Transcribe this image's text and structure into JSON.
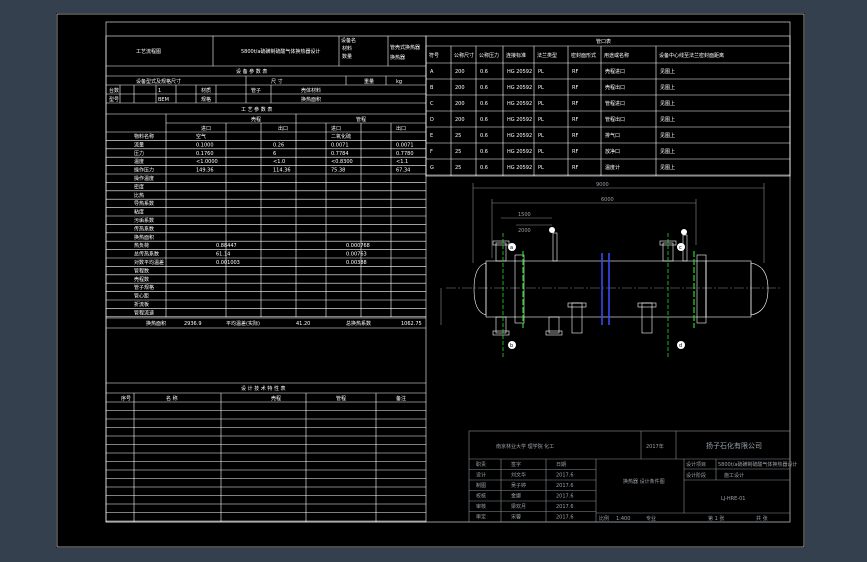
{
  "window": {
    "background": "#34404d",
    "canvas_color": "#000000"
  },
  "header": {
    "left_cell": "工艺流程图",
    "center_cell": "5800t/a硫磺制硫酸气体换热器设计",
    "right_a": "设备名",
    "right_b": "材料",
    "right_c": "换热器",
    "right_d": "管壳式换热器",
    "right_e": "数量"
  },
  "spec_title": "设 备 参 数 表",
  "spec_rows": [
    [
      "设备型式及规格尺寸",
      "尺 寸",
      "",
      "重量",
      "kg"
    ],
    [
      "台数",
      "1",
      "材质",
      "管子",
      "钢",
      "壳体材料",
      "不锈钢"
    ],
    [
      "型号",
      "BEM",
      "规格",
      "",
      "换热面积",
      ""
    ]
  ],
  "process_title": "工 艺 参 数 表",
  "process_headers": [
    "壳程",
    "管程"
  ],
  "process_sub": [
    "进口",
    "出口",
    "进口",
    "出口"
  ],
  "process_labels": [
    "物料名称",
    "流量",
    "压力",
    "温度",
    "操作压力",
    "操作温度",
    "密度",
    "比热",
    "导热系数",
    "粘度",
    "污垢系数",
    "传热系数",
    "换热面积",
    "热负荷",
    "总传热系数",
    "对数平均温差",
    "管程数",
    "壳程数",
    "管子规格",
    "管心距",
    "折流板",
    "管程流速"
  ],
  "process_values": [
    [
      "空气",
      "",
      "二氧化硫",
      ""
    ],
    [
      "0.1000",
      "0.26",
      "0.0071",
      "0.0071"
    ],
    [
      "0.1760",
      "6",
      "0.7784",
      "0.7780"
    ],
    [
      "<1.0000",
      "<1.0",
      "<0.8300",
      "<1.1"
    ],
    [
      "149.36",
      "114.36",
      "75.38",
      "67.34"
    ]
  ],
  "lower_values": [
    "0.88447",
    "0.000768",
    "61.14",
    "0.00763",
    "0.001003",
    "0.00388"
  ],
  "area_row": [
    "换热面积",
    "2936.9",
    "平均温差(实际)",
    "41.20",
    "总换热系数",
    "1062.75"
  ],
  "design_title": "设 计 技 术 特 性 表",
  "design_cols": [
    "序号",
    "名 称",
    "壳程",
    "管程",
    "备注"
  ],
  "nozzle_title": "管口表",
  "nozzle_headers": [
    "符号",
    "公称尺寸",
    "公称压力",
    "连接标准",
    "法兰类型",
    "密封面形式",
    "用途或名称",
    "设备中心线至法兰密封面距离"
  ],
  "nozzles": [
    [
      "A",
      "200",
      "0.6",
      "HG 20592",
      "PL",
      "RF",
      "壳程进口",
      "见图上"
    ],
    [
      "B",
      "200",
      "0.6",
      "HG 20592",
      "PL",
      "RF",
      "壳程出口",
      "见图上"
    ],
    [
      "C",
      "200",
      "0.6",
      "HG 20592",
      "PL",
      "RF",
      "管程进口",
      "见图上"
    ],
    [
      "D",
      "200",
      "0.6",
      "HG 20592",
      "PL",
      "RF",
      "管程出口",
      "见图上"
    ],
    [
      "E",
      "25",
      "0.6",
      "HG 20592",
      "PL",
      "RF",
      "排气口",
      "见图上"
    ],
    [
      "F",
      "25",
      "0.6",
      "HG 20592",
      "PL",
      "RF",
      "放净口",
      "见图上"
    ],
    [
      "G",
      "25",
      "0.6",
      "HG 20592",
      "PL",
      "RF",
      "温度计",
      "见图上"
    ]
  ],
  "drawing": {
    "dim_total": "9000",
    "dim_mid": "6000",
    "dim_left": "1500",
    "dim_a": "2000",
    "markers": [
      "a",
      "b",
      "c",
      "d"
    ]
  },
  "title_block": {
    "school": "南京林业大学  理学院  化工",
    "year": "2017年",
    "company": "扬子石化有限公司",
    "rows": [
      [
        "职责",
        "签字",
        "日期"
      ],
      [
        "设计",
        "刘文华",
        "2017.6"
      ],
      [
        "制图",
        "吴子婷",
        "2017.6"
      ],
      [
        "校核",
        "金娜",
        "2017.6"
      ],
      [
        "审核",
        "梁欢月",
        "2017.6"
      ],
      [
        "审定",
        "宋蓉",
        "2017.6"
      ]
    ],
    "project_label": "设计项目",
    "project_value": "5800t/a硫磺制硫酸气体换热器设计",
    "stage_label": "设计阶段",
    "stage_value": "施工设计",
    "drawing_name": "换热器\n设计条件图",
    "drawing_no": "LJ-HRE-01",
    "scale_label": "比例",
    "scale_value": "1:400",
    "sheet_label": "共 张",
    "sheet_no": "第 1 张",
    "no_label": "专业"
  }
}
